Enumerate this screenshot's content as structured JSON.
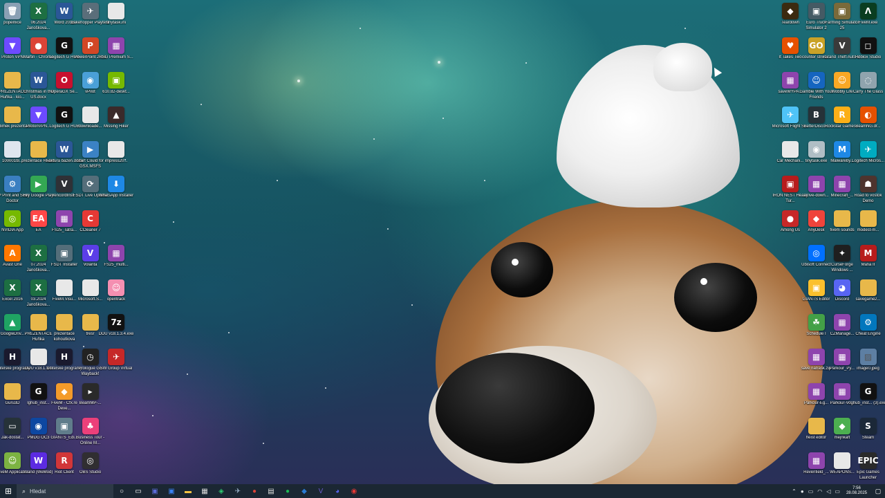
{
  "desktop": {
    "left_icons": [
      [
        {
          "label": "popelnice",
          "icon": "recycle-bin-icon",
          "color": "#8aa0b4",
          "glyph": "🗑"
        },
        {
          "label": "06.2024 Janoškova...",
          "icon": "excel-icon",
          "color": "#1d6f42",
          "glyph": "X"
        },
        {
          "label": "Word 2016",
          "icon": "word-icon",
          "color": "#2b5797",
          "glyph": "W"
        },
        {
          "label": "Lakehopper Playtest",
          "icon": "game-icon",
          "color": "#5a6e7a",
          "glyph": "✈"
        },
        {
          "label": "tinytask.ini",
          "icon": "file-icon",
          "color": "#e8e8e8",
          "glyph": ""
        }
      ],
      [
        {
          "label": "Proton VPN",
          "icon": "vpn-icon",
          "color": "#6d4aff",
          "glyph": "▼"
        },
        {
          "label": "Martin - Chrome",
          "icon": "chrome-icon",
          "color": "#db4437",
          "glyph": "●"
        },
        {
          "label": "Logitech G HUB",
          "icon": "logitech-icon",
          "color": "#111111",
          "glyph": "G"
        },
        {
          "label": "PowerPoint 2016",
          "icon": "powerpoint-icon",
          "color": "#d24726",
          "glyph": "P"
        },
        {
          "label": "RSG Premium S...",
          "icon": "rar-icon",
          "color": "#8e44ad",
          "glyph": "▦"
        }
      ],
      [
        {
          "label": "PREZENTACE Huňka - kio...",
          "icon": "folder-icon",
          "color": "#e8b84a",
          "glyph": ""
        },
        {
          "label": "Christmas in the US.docx",
          "icon": "word-doc-icon",
          "color": "#2b5797",
          "glyph": "W"
        },
        {
          "label": "OperaGX Se...",
          "icon": "opera-icon",
          "color": "#c8102e",
          "glyph": "O"
        },
        {
          "label": "vPilot",
          "icon": "vpilot-icon",
          "color": "#4aa0d8",
          "glyph": "◉"
        },
        {
          "label": "610.82-deskt...",
          "icon": "nvidia-installer-icon",
          "color": "#76b900",
          "glyph": "▣"
        }
      ],
      [
        {
          "label": "Radimek prezentace",
          "icon": "folder-icon",
          "color": "#e8b84a",
          "glyph": ""
        },
        {
          "label": "ProtonVPN...",
          "icon": "vpn-icon",
          "color": "#6d4aff",
          "glyph": "▼"
        },
        {
          "label": "Logitech G HUB",
          "icon": "logitech-icon",
          "color": "#111111",
          "glyph": "G"
        },
        {
          "label": "downloade...",
          "icon": "file-icon",
          "color": "#e8e8e8",
          "glyph": ""
        },
        {
          "label": "Missing Hiker",
          "icon": "game-icon",
          "color": "#3a2a2a",
          "glyph": "▲"
        }
      ],
      [
        {
          "label": "100001t8...",
          "icon": "image-icon",
          "color": "#dfe6ee",
          "glyph": ""
        },
        {
          "label": "prezentace Radim",
          "icon": "folder-icon",
          "color": "#e8b84a",
          "glyph": ""
        },
        {
          "label": "Faktura bazén.docx",
          "icon": "word-doc-icon",
          "color": "#2b5797",
          "glyph": "W"
        },
        {
          "label": "Start Could for GSX.MSFS",
          "icon": "app-icon",
          "color": "#3b82c4",
          "glyph": "▶"
        },
        {
          "label": "impress20...",
          "icon": "file-icon",
          "color": "#e8e8e8",
          "glyph": ""
        }
      ],
      [
        {
          "label": "HP Print and Scan Doctor",
          "icon": "hp-icon",
          "color": "#3a7fc1",
          "glyph": "⚙"
        },
        {
          "label": "Hry Google Play",
          "icon": "google-play-icon",
          "color": "#34a853",
          "glyph": "▶"
        },
        {
          "label": "VencordInst...",
          "icon": "vencord-icon",
          "color": "#2f3136",
          "glyph": "V"
        },
        {
          "label": "FSDT Live Update",
          "icon": "app-icon",
          "color": "#546e7a",
          "glyph": "⟳"
        },
        {
          "label": "WhatsApp Installer",
          "icon": "installer-icon",
          "color": "#1e88e5",
          "glyph": "⬇"
        }
      ],
      [
        {
          "label": "NVIDIA App",
          "icon": "nvidia-icon",
          "color": "#76b900",
          "glyph": "◎"
        },
        {
          "label": "EA",
          "icon": "ea-icon",
          "color": "#ff4747",
          "glyph": "EA"
        },
        {
          "label": "FS25_Tatra...",
          "icon": "rar-icon",
          "color": "#8e44ad",
          "glyph": "▦"
        },
        {
          "label": "CCleaner 7",
          "icon": "ccleaner-icon",
          "color": "#e53935",
          "glyph": "C"
        }
      ],
      [
        {
          "label": "Avast One",
          "icon": "avast-icon",
          "color": "#ff7800",
          "glyph": "A"
        },
        {
          "label": "07.2024 Janoškova...",
          "icon": "excel-icon",
          "color": "#1d6f42",
          "glyph": "X"
        },
        {
          "label": "FSDT Installer",
          "icon": "app-icon",
          "color": "#546e7a",
          "glyph": "▣"
        },
        {
          "label": "Volanta",
          "icon": "volanta-icon",
          "color": "#5b3ee8",
          "glyph": "V"
        },
        {
          "label": "FS25_multi...",
          "icon": "rar-icon",
          "color": "#8e44ad",
          "glyph": "▦"
        }
      ],
      [
        {
          "label": "Excel 2016",
          "icon": "excel-icon",
          "color": "#1d6f42",
          "glyph": "X"
        },
        {
          "label": "03.2024 Janoškova...",
          "icon": "excel-icon",
          "color": "#1d6f42",
          "glyph": "X"
        },
        {
          "label": "FiveM.Visu...",
          "icon": "file-icon",
          "color": "#e8e8e8",
          "glyph": ""
        },
        {
          "label": "Microsoft.S...",
          "icon": "file-icon",
          "color": "#e8e8e8",
          "glyph": ""
        },
        {
          "label": "opentrack",
          "icon": "opentrack-icon",
          "color": "#f48fb1",
          "glyph": "☺"
        }
      ],
      [
        {
          "label": "GoogleDriv...",
          "icon": "google-drive-icon",
          "color": "#1fa463",
          "glyph": "▲"
        },
        {
          "label": "PREZENTACE Huňka",
          "icon": "folder-icon",
          "color": "#e8b84a",
          "glyph": ""
        },
        {
          "label": "prezentace kohoutkova",
          "icon": "folder-icon",
          "color": "#e8b84a",
          "glyph": ""
        },
        {
          "label": "tresr",
          "icon": "folder-icon",
          "color": "#e8b84a",
          "glyph": ""
        },
        {
          "label": "DDU v18.1.3.4.exe",
          "icon": "7zip-icon",
          "color": "#111111",
          "glyph": "7z"
        }
      ],
      [
        {
          "label": "Učitelské programy",
          "icon": "hal-icon",
          "color": "#1a1a2e",
          "glyph": "H"
        },
        {
          "label": "DDU v18.1.3.4",
          "icon": "file-icon",
          "color": "#e8e8e8",
          "glyph": ""
        },
        {
          "label": "Učitelské programy",
          "icon": "hal-icon",
          "color": "#1a1a2e",
          "glyph": "H"
        },
        {
          "label": "Prologue Go Wayback!",
          "icon": "game-icon",
          "color": "#222222",
          "glyph": "◷"
        },
        {
          "label": "SW Group Virtual",
          "icon": "app-icon",
          "color": "#c62828",
          "glyph": "✈"
        }
      ],
      [
        {
          "label": "Guru3D",
          "icon": "folder-icon",
          "color": "#e8b84a",
          "glyph": ""
        },
        {
          "label": "lghub_inst...",
          "icon": "logitech-icon",
          "color": "#111111",
          "glyph": "G"
        },
        {
          "label": "FiveM - Cfx.re Deve...",
          "icon": "fivem-icon",
          "color": "#f49b2a",
          "glyph": "◆"
        },
        {
          "label": "BeamMP-...",
          "icon": "beammp-icon",
          "color": "#2a2a2a",
          "glyph": "▸"
        }
      ],
      [
        {
          "label": "Jak-dostat...",
          "icon": "app-icon",
          "color": "#263238",
          "glyph": "▭"
        },
        {
          "label": "PMDG OC3",
          "icon": "pmdg-icon",
          "color": "#0d47a1",
          "glyph": "◉"
        },
        {
          "label": "GIANTS_Edi...",
          "icon": "giants-icon",
          "color": "#607d8b",
          "glyph": "▣"
        },
        {
          "label": "Business Tour - Online M...",
          "icon": "game-icon",
          "color": "#ec407a",
          "glyph": "♣"
        }
      ],
      [
        {
          "label": "FiveM Applicati...",
          "icon": "fivem-icon",
          "color": "#7cb342",
          "glyph": "☺"
        },
        {
          "label": "Wand (WeMod)",
          "icon": "wand-icon",
          "color": "#5c2be2",
          "glyph": "W"
        },
        {
          "label": "Riot Client",
          "icon": "riot-icon",
          "color": "#d13639",
          "glyph": "R"
        },
        {
          "label": "OBS Studio",
          "icon": "obs-icon",
          "color": "#302e31",
          "glyph": "◎"
        }
      ]
    ],
    "right_icons": [
      [
        {
          "label": "Teardown",
          "icon": "teardown-icon",
          "color": "#3b2a10",
          "glyph": "◆"
        },
        {
          "label": "Euro Truck Simulator 2",
          "icon": "ets2-icon",
          "color": "#455a64",
          "glyph": "▣"
        },
        {
          "label": "Farming Simulator 25",
          "icon": "fs25-icon",
          "color": "#7a6a3a",
          "glyph": "▣"
        },
        {
          "label": "FiveM.exe",
          "icon": "fivem-icon",
          "color": "#0a3d20",
          "glyph": "Λ"
        }
      ],
      [
        {
          "label": "It Takes Two",
          "icon": "game-icon",
          "color": "#e65100",
          "glyph": "♥"
        },
        {
          "label": "counter strike...",
          "icon": "csgo-icon",
          "color": "#c9a227",
          "glyph": "GO"
        },
        {
          "label": "Grand Theft Auto V",
          "icon": "gta-icon",
          "color": "#3a3a3a",
          "glyph": "V"
        },
        {
          "label": "Roblox Studio",
          "icon": "roblox-icon",
          "color": "#111111",
          "glyph": "◻"
        }
      ],
      [
        {
          "label": "saveWYPA...",
          "icon": "rar-icon",
          "color": "#8e44ad",
          "glyph": "▦"
        },
        {
          "label": "Gamble With Your Friends",
          "icon": "game-icon",
          "color": "#1565c0",
          "glyph": "☺"
        },
        {
          "label": "Wobbly Life",
          "icon": "game-icon",
          "color": "#f9a825",
          "glyph": "☺"
        },
        {
          "label": "Carry The Glass",
          "icon": "game-icon",
          "color": "#90a4ae",
          "glyph": "◌"
        }
      ],
      [
        {
          "label": "Microsoft Flight Si...",
          "icon": "msfs-icon",
          "color": "#4fc3f7",
          "glyph": "✈"
        },
        {
          "label": "BetterDisco...",
          "icon": "betterdiscord-icon",
          "color": "#263238",
          "glyph": "B"
        },
        {
          "label": "Rockstar Games...",
          "icon": "rockstar-icon",
          "color": "#fcaf17",
          "glyph": "R"
        },
        {
          "label": "BeamNG.dr...",
          "icon": "beamng-icon",
          "color": "#e65100",
          "glyph": "◐"
        }
      ],
      [
        {
          "label": "Car Mechani...",
          "icon": "file-icon",
          "color": "#e8e8e8",
          "glyph": ""
        },
        {
          "label": "tinytask.exe",
          "icon": "tinytask-icon",
          "color": "#b0bec5",
          "glyph": "◉"
        },
        {
          "label": "Malwareby...",
          "icon": "malwarebytes-icon",
          "color": "#1e88e5",
          "glyph": "M"
        },
        {
          "label": "Logitech Micros...",
          "icon": "app-icon",
          "color": "#00acc1",
          "glyph": "✈"
        }
      ],
      [
        {
          "label": "IRON NEST Heavy Tur...",
          "icon": "game-icon",
          "color": "#b71c1c",
          "glyph": "▣"
        },
        {
          "label": "arrive-down...",
          "icon": "rar-icon",
          "color": "#8e44ad",
          "glyph": "▦"
        },
        {
          "label": "Minecraft_...",
          "icon": "rar-icon",
          "color": "#8e44ad",
          "glyph": "▦"
        },
        {
          "label": "Road to vostok Demo",
          "icon": "game-icon",
          "color": "#4e342e",
          "glyph": "☗"
        }
      ],
      [
        {
          "label": "Among Us",
          "icon": "amongus-icon",
          "color": "#c62828",
          "glyph": "●"
        },
        {
          "label": "AnyDesk",
          "icon": "anydesk-icon",
          "color": "#ef443b",
          "glyph": "◆"
        },
        {
          "label": "fivem sounds",
          "icon": "folder-icon",
          "color": "#e8b84a",
          "glyph": ""
        },
        {
          "label": "modest-m...",
          "icon": "folder-icon",
          "color": "#e8b84a",
          "glyph": ""
        }
      ],
      [
        {
          "label": "",
          "icon": "",
          "color": "",
          "glyph": ""
        },
        {
          "label": "Ubisoft Connect",
          "icon": "ubisoft-icon",
          "color": "#0070ff",
          "glyph": "◎"
        },
        {
          "label": "CurseForge Windows ...",
          "icon": "curseforge-icon",
          "color": "#1f1f1f",
          "glyph": "✦"
        },
        {
          "label": "Mafia II",
          "icon": "game-icon",
          "color": "#b71c1c",
          "glyph": "M"
        }
      ],
      [
        {
          "label": "",
          "icon": "",
          "color": "",
          "glyph": ""
        },
        {
          "label": "GIANTS Editor",
          "icon": "giants-icon",
          "color": "#fbc02d",
          "glyph": "▣"
        },
        {
          "label": "Discord",
          "icon": "discord-icon",
          "color": "#5865f2",
          "glyph": "◕"
        },
        {
          "label": "savegame2...",
          "icon": "folder-icon",
          "color": "#e8b84a",
          "glyph": ""
        }
      ],
      [
        {
          "label": "",
          "icon": "",
          "color": "",
          "glyph": ""
        },
        {
          "label": "Schedule I",
          "icon": "game-icon",
          "color": "#43a047",
          "glyph": "☘"
        },
        {
          "label": "CZManage...",
          "icon": "rar-icon",
          "color": "#8e44ad",
          "glyph": "▦"
        },
        {
          "label": "Cheat Engine",
          "icon": "cheatengine-icon",
          "color": "#0277bd",
          "glyph": "⚙"
        }
      ],
      [
        {
          "label": "",
          "icon": "",
          "color": "",
          "glyph": ""
        },
        {
          "label": "save natrask.zip",
          "icon": "rar-icon",
          "color": "#8e44ad",
          "glyph": "▦"
        },
        {
          "label": "Parkour_Py...",
          "icon": "rar-icon",
          "color": "#8e44ad",
          "glyph": "▦"
        },
        {
          "label": "image0.jpeg",
          "icon": "image-icon",
          "color": "#5d7fa3",
          "glyph": "▨"
        }
      ],
      [
        {
          "label": "",
          "icon": "",
          "color": "",
          "glyph": ""
        },
        {
          "label": "Parkour-Eg...",
          "icon": "rar-icon",
          "color": "#8e44ad",
          "glyph": "▦"
        },
        {
          "label": "Parkour-Vo...",
          "icon": "rar-icon",
          "color": "#8e44ad",
          "glyph": "▦"
        },
        {
          "label": "lghub_inst... (3).exe",
          "icon": "logitech-icon",
          "color": "#111111",
          "glyph": "G"
        }
      ],
      [
        {
          "label": "",
          "icon": "",
          "color": "",
          "glyph": ""
        },
        {
          "label": "heist editor",
          "icon": "folder-icon",
          "color": "#e8b84a",
          "glyph": ""
        },
        {
          "label": "mejnkaft",
          "icon": "minecraft-icon",
          "color": "#4caf50",
          "glyph": "◆"
        },
        {
          "label": "Steam",
          "icon": "steam-icon",
          "color": "#1b2838",
          "glyph": "S"
        }
      ],
      [
        {
          "label": "",
          "icon": "",
          "color": "",
          "glyph": ""
        },
        {
          "label": "Revenfield_...",
          "icon": "rar-icon",
          "color": "#8e44ad",
          "glyph": "▦"
        },
        {
          "label": "WEAPONS...",
          "icon": "file-icon",
          "color": "#e8e8e8",
          "glyph": ""
        },
        {
          "label": "Epic Games Launcher",
          "icon": "epic-icon",
          "color": "#2a2a2a",
          "glyph": "EPIC"
        }
      ]
    ]
  },
  "taskbar": {
    "search_placeholder": "Hledat",
    "apps": [
      {
        "name": "task-view-button",
        "color": "#ffffff",
        "glyph": "○"
      },
      {
        "name": "widgets-button",
        "color": "#ffffff",
        "glyph": "▭"
      },
      {
        "name": "file-manager-button",
        "color": "#5b6bd8",
        "glyph": "▣"
      },
      {
        "name": "store-button",
        "color": "#3b82f6",
        "glyph": "▣"
      },
      {
        "name": "explorer-button",
        "color": "#f6c343",
        "glyph": "▬"
      },
      {
        "name": "calculator-button",
        "color": "#dddddd",
        "glyph": "▦"
      },
      {
        "name": "wemod-button",
        "color": "#2ecc71",
        "glyph": "◈"
      },
      {
        "name": "steam-button",
        "color": "#a0b8d0",
        "glyph": "✈"
      },
      {
        "name": "chrome-button",
        "color": "#db4437",
        "glyph": "●"
      },
      {
        "name": "notepad-button",
        "color": "#e0e0e0",
        "glyph": "▤"
      },
      {
        "name": "spotify-button",
        "color": "#1db954",
        "glyph": "●"
      },
      {
        "name": "outlook-button",
        "color": "#2a7ad2",
        "glyph": "◆"
      },
      {
        "name": "volanta-button",
        "color": "#6a5acd",
        "glyph": "V"
      },
      {
        "name": "discord-button",
        "color": "#5865f2",
        "glyph": "◕"
      },
      {
        "name": "recorder-button",
        "color": "#e53935",
        "glyph": "◉"
      }
    ],
    "tray": {
      "time": "7:56",
      "date": "28.08.2025",
      "notification_count": "2"
    }
  }
}
